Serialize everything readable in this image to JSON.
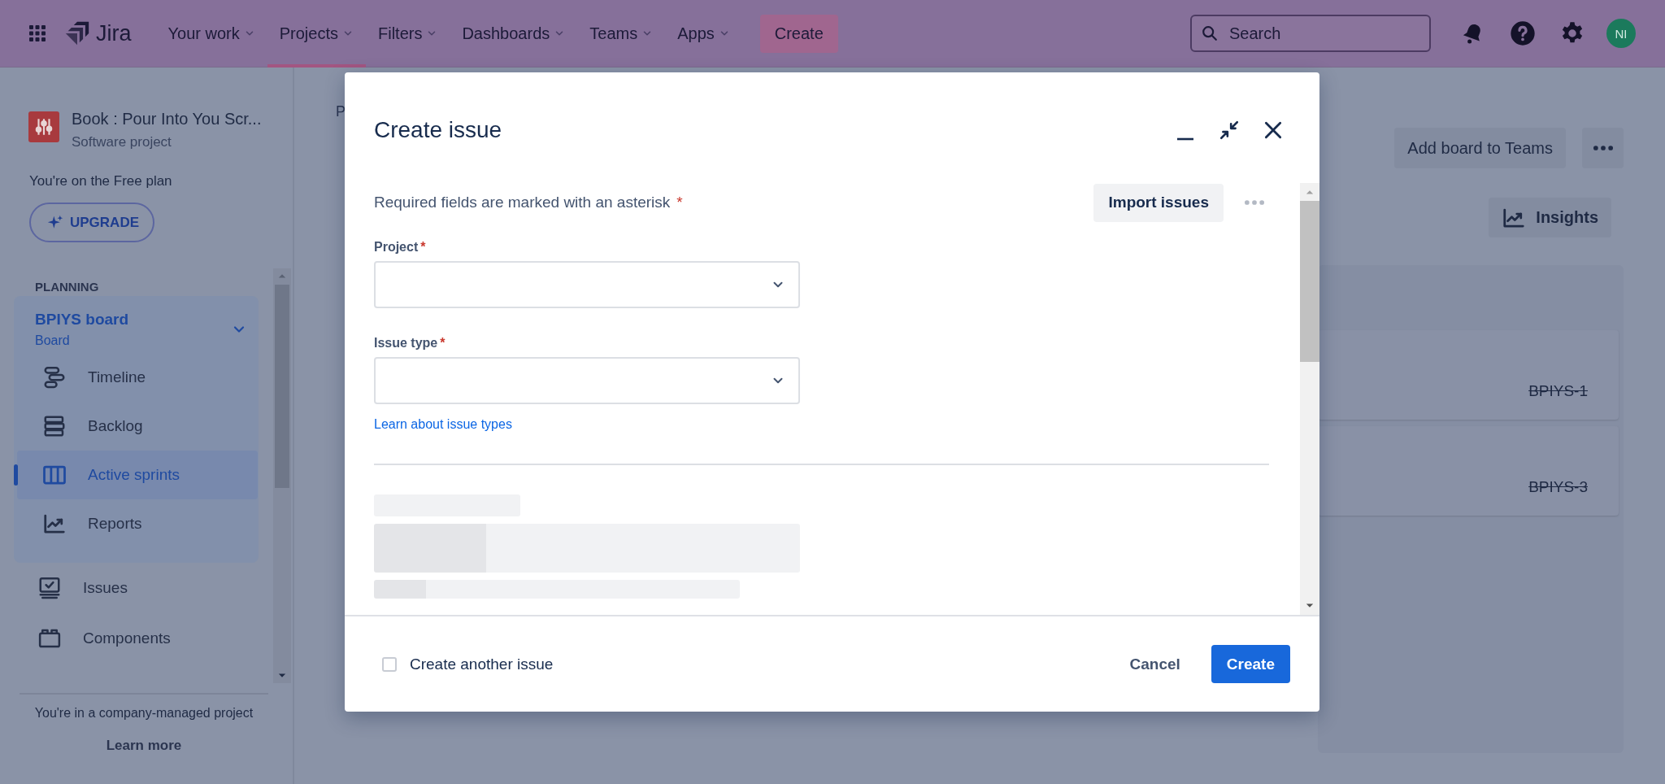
{
  "topbar": {
    "logo": "Jira",
    "nav": [
      {
        "label": "Your work",
        "selected": false
      },
      {
        "label": "Projects",
        "selected": true
      },
      {
        "label": "Filters",
        "selected": false
      },
      {
        "label": "Dashboards",
        "selected": false
      },
      {
        "label": "Teams",
        "selected": false
      },
      {
        "label": "Apps",
        "selected": false
      }
    ],
    "create_button": "Create",
    "search": {
      "placeholder": "Search"
    },
    "avatar": "NI"
  },
  "sidebar": {
    "project": {
      "name": "Book : Pour Into You Scr...",
      "type": "Software project"
    },
    "plan_note": "You're on the Free plan",
    "upgrade_button": "UPGRADE",
    "section": "PLANNING",
    "board": {
      "name": "BPIYS board",
      "subtitle": "Board",
      "expanded": true,
      "items": [
        {
          "label": "Timeline",
          "kind": "timeline",
          "selected": false
        },
        {
          "label": "Backlog",
          "kind": "backlog",
          "selected": false
        },
        {
          "label": "Active sprints",
          "kind": "board",
          "selected": true
        },
        {
          "label": "Reports",
          "kind": "reports",
          "selected": false
        }
      ]
    },
    "items": [
      {
        "label": "Issues",
        "kind": "issues"
      },
      {
        "label": "Components",
        "kind": "components"
      }
    ],
    "footer_note": "You're in a company-managed project",
    "learn_more": "Learn more"
  },
  "board": {
    "breadcrumb": "P",
    "add_to_teams_button": "Add board to Teams",
    "insights_button": "Insights",
    "cards": [
      {
        "key": "BPIYS-1",
        "done": true
      },
      {
        "key": "BPIYS-3",
        "done": true
      }
    ]
  },
  "dialog": {
    "title": "Create issue",
    "required_note": "Required fields are marked with an asterisk",
    "required_note_mark": "*",
    "import_button": "Import issues",
    "fields": [
      {
        "label": "Project",
        "required_mark": "*"
      },
      {
        "label": "Issue type",
        "required_mark": "*"
      }
    ],
    "learn_link": "Learn about issue types",
    "create_another": {
      "label": "Create another issue",
      "checked": false
    },
    "cancel_button": "Cancel",
    "submit_button": "Create"
  }
}
